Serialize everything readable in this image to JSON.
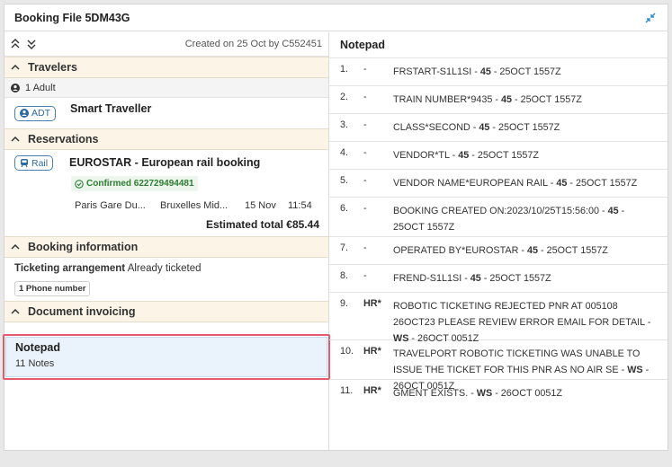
{
  "window": {
    "title": "Booking File 5DM43G",
    "collapse_icon": "collapse-icon"
  },
  "left": {
    "created": "Created on 25 Oct by C552451",
    "sections": {
      "travelers": "Travelers",
      "reservations": "Reservations",
      "booking_info": "Booking information",
      "document_invoicing": "Document invoicing"
    },
    "travelers": {
      "summary": "1 Adult",
      "type": "ADT",
      "name": "Smart Traveller"
    },
    "reservation": {
      "kind": "Rail",
      "title": "EUROSTAR - European rail booking",
      "status": "Confirmed 622729494481",
      "from": "Paris Gare Du...",
      "to": "Bruxelles Mid...",
      "date": "15 Nov",
      "time": "11:54",
      "total": "Estimated total €85.44"
    },
    "booking_info": {
      "label": "Ticketing arrangement",
      "value": "Already ticketed",
      "chip": "1 Phone number"
    },
    "notepad_card": {
      "title": "Notepad",
      "subtitle": "11 Notes"
    }
  },
  "notepad": {
    "title": "Notepad",
    "notes": [
      {
        "num": "1.",
        "type": "-",
        "text": "FRSTART-S1L1SI",
        "agent": "45",
        "stamp": "25OCT 1557Z"
      },
      {
        "num": "2.",
        "type": "-",
        "text": "TRAIN NUMBER*9435",
        "agent": "45",
        "stamp": "25OCT 1557Z"
      },
      {
        "num": "3.",
        "type": "-",
        "text": "CLASS*SECOND",
        "agent": "45",
        "stamp": "25OCT 1557Z"
      },
      {
        "num": "4.",
        "type": "-",
        "text": "VENDOR*TL",
        "agent": "45",
        "stamp": "25OCT 1557Z"
      },
      {
        "num": "5.",
        "type": "-",
        "text": "VENDOR NAME*EUROPEAN RAIL",
        "agent": "45",
        "stamp": "25OCT 1557Z"
      },
      {
        "num": "6.",
        "type": "-",
        "text": "BOOKING CREATED ON:2023/10/25T15:56:00",
        "agent": "45",
        "stamp": "25OCT 1557Z"
      },
      {
        "num": "7.",
        "type": "-",
        "text": "OPERATED BY*EUROSTAR",
        "agent": "45",
        "stamp": "25OCT 1557Z"
      },
      {
        "num": "8.",
        "type": "-",
        "text": "FREND-S1L1SI",
        "agent": "45",
        "stamp": "25OCT 1557Z"
      },
      {
        "num": "9.",
        "type": "HR*",
        "text": "ROBOTIC TICKETING REJECTED PNR AT 005108 26OCT23 PLEASE REVIEW ERROR EMAIL FOR DETAIL",
        "agent": "WS",
        "stamp": "26OCT 0051Z"
      },
      {
        "num": "10.",
        "type": "HR*",
        "text": "TRAVELPORT ROBOTIC TICKETING WAS UNABLE TO ISSUE THE TICKET FOR THIS PNR AS NO AIR SE",
        "agent": "WS",
        "stamp": "26OCT 0051Z"
      },
      {
        "num": "11.",
        "type": "HR*",
        "text": "GMENT EXISTS.",
        "agent": "WS",
        "stamp": "26OCT 0051Z"
      }
    ]
  },
  "colors": {
    "accent": "#2e6aa0",
    "section_bg": "#fcf4e7",
    "highlight": "#e55a6c",
    "confirmed": "#2e7d32"
  }
}
